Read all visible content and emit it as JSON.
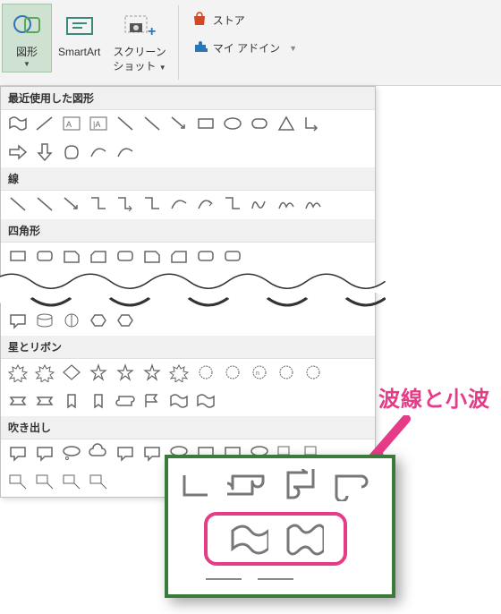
{
  "ribbon": {
    "shapes_label": "図形",
    "smartart_label": "SmartArt",
    "screenshot_label_1": "スクリーン",
    "screenshot_label_2": "ショット"
  },
  "addins": {
    "store_label": "ストア",
    "my_addins_label": "マイ アドイン"
  },
  "sections": {
    "recent": "最近使用した図形",
    "lines": "線",
    "rectangles": "四角形",
    "stars_ribbons": "星とリボン",
    "callouts": "吹き出し"
  },
  "annotation": {
    "text": "波線と小波"
  },
  "shape_rows": {
    "recent_count_row1": 12,
    "recent_count_row2": 5,
    "lines_count": 12,
    "rect_count": 9,
    "basic_count": 5,
    "stars_row1": 12,
    "stars_row2": 8,
    "callouts_row1": 12,
    "callouts_row2": 4
  }
}
